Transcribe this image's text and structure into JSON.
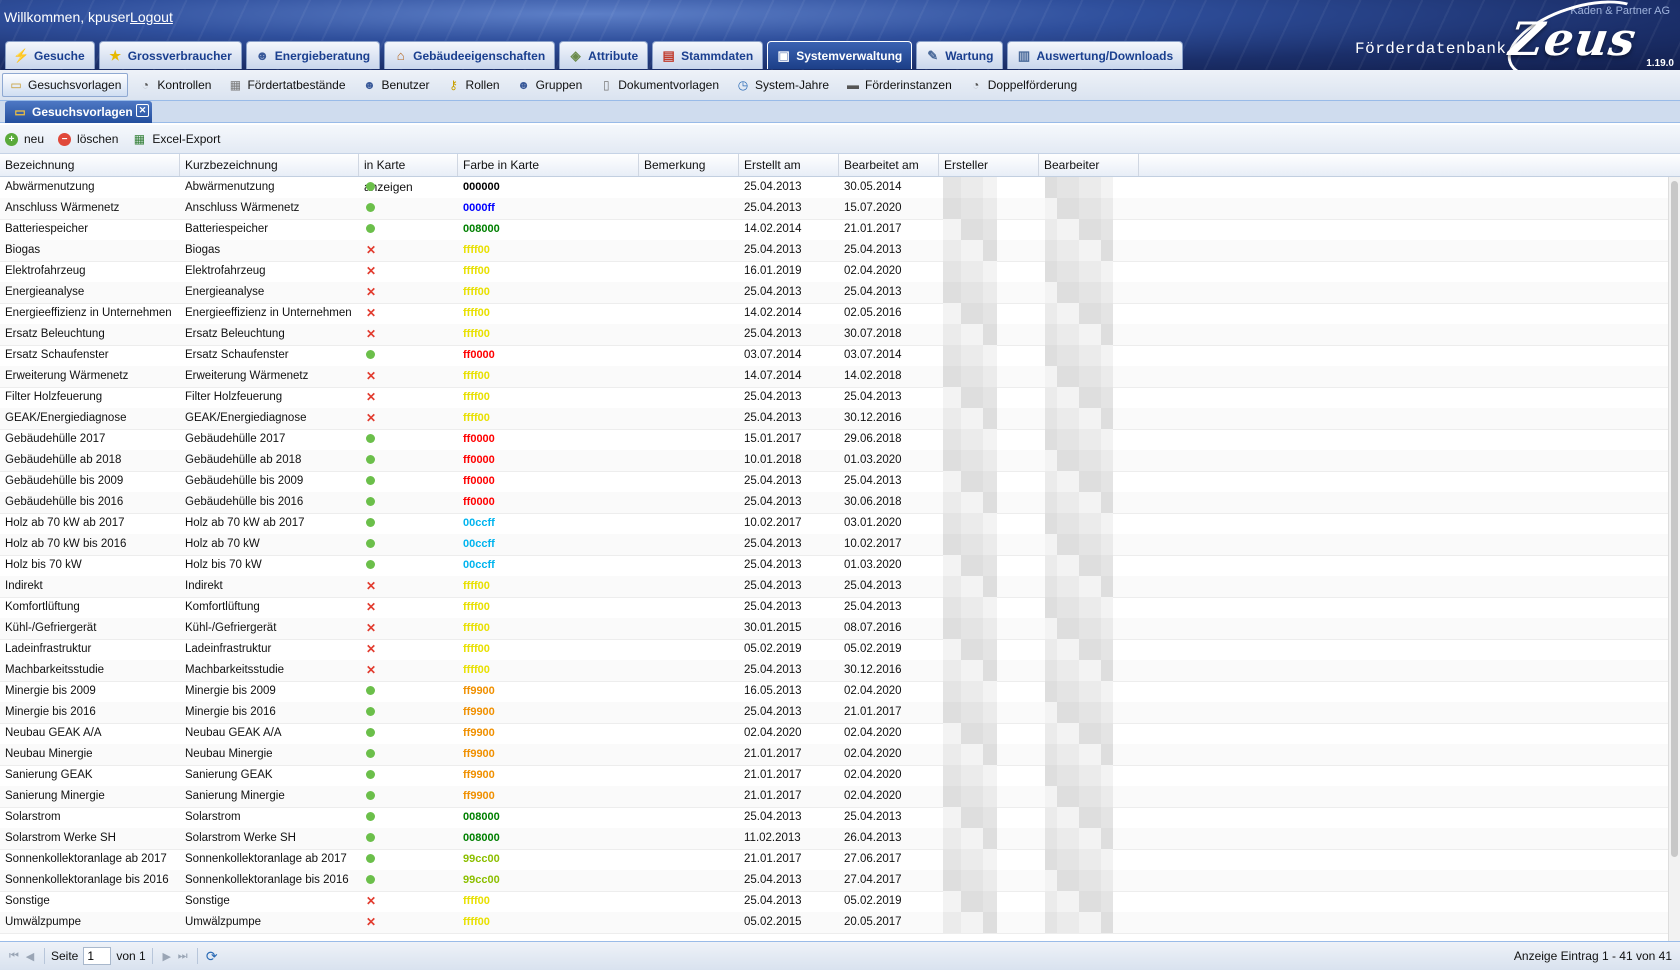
{
  "header": {
    "welcome": "Willkommen, kpuser",
    "logout": "Logout",
    "company": "Kaden & Partner AG",
    "app_name": "Förderdatenbank",
    "logo": "Zeus",
    "version": "1.19.0"
  },
  "main_tabs": [
    {
      "label": "Gesuche",
      "icon": "lightning-icon"
    },
    {
      "label": "Grossverbraucher",
      "icon": "star-icon"
    },
    {
      "label": "Energieberatung",
      "icon": "person-icon"
    },
    {
      "label": "Gebäudeeigenschaften",
      "icon": "house-icon"
    },
    {
      "label": "Attribute",
      "icon": "tag-icon"
    },
    {
      "label": "Stammdaten",
      "icon": "database-icon"
    },
    {
      "label": "Systemverwaltung",
      "icon": "window-icon",
      "active": true
    },
    {
      "label": "Wartung",
      "icon": "wrench-icon"
    },
    {
      "label": "Auswertung/Downloads",
      "icon": "report-icon"
    }
  ],
  "sub_tabs": [
    {
      "label": "Gesuchsvorlagen",
      "icon": "form-icon",
      "active": true
    },
    {
      "label": "Kontrollen",
      "icon": "check-icon"
    },
    {
      "label": "Fördertatbestände",
      "icon": "list-icon"
    },
    {
      "label": "Benutzer",
      "icon": "user-icon"
    },
    {
      "label": "Rollen",
      "icon": "key-icon"
    },
    {
      "label": "Gruppen",
      "icon": "group-icon"
    },
    {
      "label": "Dokumentvorlagen",
      "icon": "document-icon"
    },
    {
      "label": "System-Jahre",
      "icon": "clock-icon"
    },
    {
      "label": "Förderinstanzen",
      "icon": "truck-icon"
    },
    {
      "label": "Doppelförderung",
      "icon": "duplicate-icon"
    }
  ],
  "doc_tab": {
    "label": "Gesuchsvorlagen"
  },
  "toolbar": {
    "new": "neu",
    "delete": "löschen",
    "export": "Excel-Export"
  },
  "columns": [
    "Bezeichnung",
    "Kurzbezeichnung",
    "in Karte anzeigen",
    "Farbe in Karte",
    "Bemerkung",
    "Erstellt am",
    "Bearbeitet am",
    "Ersteller",
    "Bearbeiter"
  ],
  "colors": {
    "check": "#6bbf4a",
    "cross": "#e23b2e",
    "header_dark": "#1b2f6a",
    "tab_active": "#234e9d"
  },
  "rows": [
    {
      "bez": "Abwärmenutzung",
      "kurz": "Abwärmenutzung",
      "karte": true,
      "farbe": "000000",
      "fc": "#000000",
      "erstellt": "25.04.2013",
      "bearbeitet": "30.05.2014"
    },
    {
      "bez": "Anschluss Wärmenetz",
      "kurz": "Anschluss Wärmenetz",
      "karte": true,
      "farbe": "0000ff",
      "fc": "#0000ff",
      "erstellt": "25.04.2013",
      "bearbeitet": "15.07.2020"
    },
    {
      "bez": "Batteriespeicher",
      "kurz": "Batteriespeicher",
      "karte": true,
      "farbe": "008000",
      "fc": "#008000",
      "erstellt": "14.02.2014",
      "bearbeitet": "21.01.2017"
    },
    {
      "bez": "Biogas",
      "kurz": "Biogas",
      "karte": false,
      "farbe": "ffff00",
      "fc": "#e8e000",
      "erstellt": "25.04.2013",
      "bearbeitet": "25.04.2013"
    },
    {
      "bez": "Elektrofahrzeug",
      "kurz": "Elektrofahrzeug",
      "karte": false,
      "farbe": "ffff00",
      "fc": "#e8e000",
      "erstellt": "16.01.2019",
      "bearbeitet": "02.04.2020"
    },
    {
      "bez": "Energieanalyse",
      "kurz": "Energieanalyse",
      "karte": false,
      "farbe": "ffff00",
      "fc": "#e8e000",
      "erstellt": "25.04.2013",
      "bearbeitet": "25.04.2013"
    },
    {
      "bez": "Energieeffizienz in Unternehmen",
      "kurz": "Energieeffizienz in Unternehmen",
      "karte": false,
      "farbe": "ffff00",
      "fc": "#e8e000",
      "erstellt": "14.02.2014",
      "bearbeitet": "02.05.2016"
    },
    {
      "bez": "Ersatz Beleuchtung",
      "kurz": "Ersatz Beleuchtung",
      "karte": false,
      "farbe": "ffff00",
      "fc": "#e8e000",
      "erstellt": "25.04.2013",
      "bearbeitet": "30.07.2018"
    },
    {
      "bez": "Ersatz Schaufenster",
      "kurz": "Ersatz Schaufenster",
      "karte": true,
      "farbe": "ff0000",
      "fc": "#ff0000",
      "erstellt": "03.07.2014",
      "bearbeitet": "03.07.2014"
    },
    {
      "bez": "Erweiterung Wärmenetz",
      "kurz": "Erweiterung Wärmenetz",
      "karte": false,
      "farbe": "ffff00",
      "fc": "#e8e000",
      "erstellt": "14.07.2014",
      "bearbeitet": "14.02.2018"
    },
    {
      "bez": "Filter Holzfeuerung",
      "kurz": "Filter Holzfeuerung",
      "karte": false,
      "farbe": "ffff00",
      "fc": "#e8e000",
      "erstellt": "25.04.2013",
      "bearbeitet": "25.04.2013"
    },
    {
      "bez": "GEAK/Energiediagnose",
      "kurz": "GEAK/Energiediagnose",
      "karte": false,
      "farbe": "ffff00",
      "fc": "#e8e000",
      "erstellt": "25.04.2013",
      "bearbeitet": "30.12.2016"
    },
    {
      "bez": "Gebäudehülle 2017",
      "kurz": "Gebäudehülle 2017",
      "karte": true,
      "farbe": "ff0000",
      "fc": "#ff0000",
      "erstellt": "15.01.2017",
      "bearbeitet": "29.06.2018"
    },
    {
      "bez": "Gebäudehülle ab 2018",
      "kurz": "Gebäudehülle ab 2018",
      "karte": true,
      "farbe": "ff0000",
      "fc": "#ff0000",
      "erstellt": "10.01.2018",
      "bearbeitet": "01.03.2020"
    },
    {
      "bez": "Gebäudehülle bis 2009",
      "kurz": "Gebäudehülle bis 2009",
      "karte": true,
      "farbe": "ff0000",
      "fc": "#ff0000",
      "erstellt": "25.04.2013",
      "bearbeitet": "25.04.2013"
    },
    {
      "bez": "Gebäudehülle bis 2016",
      "kurz": "Gebäudehülle bis 2016",
      "karte": true,
      "farbe": "ff0000",
      "fc": "#ff0000",
      "erstellt": "25.04.2013",
      "bearbeitet": "30.06.2018"
    },
    {
      "bez": "Holz ab 70 kW ab 2017",
      "kurz": "Holz ab 70 kW ab 2017",
      "karte": true,
      "farbe": "00ccff",
      "fc": "#00b4ee",
      "erstellt": "10.02.2017",
      "bearbeitet": "03.01.2020"
    },
    {
      "bez": "Holz ab 70 kW bis 2016",
      "kurz": "Holz ab 70 kW",
      "karte": true,
      "farbe": "00ccff",
      "fc": "#00b4ee",
      "erstellt": "25.04.2013",
      "bearbeitet": "10.02.2017"
    },
    {
      "bez": "Holz bis 70 kW",
      "kurz": "Holz bis 70 kW",
      "karte": true,
      "farbe": "00ccff",
      "fc": "#00b4ee",
      "erstellt": "25.04.2013",
      "bearbeitet": "01.03.2020"
    },
    {
      "bez": "Indirekt",
      "kurz": "Indirekt",
      "karte": false,
      "farbe": "ffff00",
      "fc": "#e8e000",
      "erstellt": "25.04.2013",
      "bearbeitet": "25.04.2013"
    },
    {
      "bez": "Komfortlüftung",
      "kurz": "Komfortlüftung",
      "karte": false,
      "farbe": "ffff00",
      "fc": "#e8e000",
      "erstellt": "25.04.2013",
      "bearbeitet": "25.04.2013"
    },
    {
      "bez": "Kühl-/Gefriergerät",
      "kurz": "Kühl-/Gefriergerät",
      "karte": false,
      "farbe": "ffff00",
      "fc": "#e8e000",
      "erstellt": "30.01.2015",
      "bearbeitet": "08.07.2016"
    },
    {
      "bez": "Ladeinfrastruktur",
      "kurz": "Ladeinfrastruktur",
      "karte": false,
      "farbe": "ffff00",
      "fc": "#e8e000",
      "erstellt": "05.02.2019",
      "bearbeitet": "05.02.2019"
    },
    {
      "bez": "Machbarkeitsstudie",
      "kurz": "Machbarkeitsstudie",
      "karte": false,
      "farbe": "ffff00",
      "fc": "#e8e000",
      "erstellt": "25.04.2013",
      "bearbeitet": "30.12.2016"
    },
    {
      "bez": "Minergie bis 2009",
      "kurz": "Minergie bis 2009",
      "karte": true,
      "farbe": "ff9900",
      "fc": "#f09000",
      "erstellt": "16.05.2013",
      "bearbeitet": "02.04.2020"
    },
    {
      "bez": "Minergie bis 2016",
      "kurz": "Minergie bis 2016",
      "karte": true,
      "farbe": "ff9900",
      "fc": "#f09000",
      "erstellt": "25.04.2013",
      "bearbeitet": "21.01.2017"
    },
    {
      "bez": "Neubau GEAK A/A",
      "kurz": "Neubau GEAK A/A",
      "karte": true,
      "farbe": "ff9900",
      "fc": "#f09000",
      "erstellt": "02.04.2020",
      "bearbeitet": "02.04.2020"
    },
    {
      "bez": "Neubau Minergie",
      "kurz": "Neubau Minergie",
      "karte": true,
      "farbe": "ff9900",
      "fc": "#f09000",
      "erstellt": "21.01.2017",
      "bearbeitet": "02.04.2020"
    },
    {
      "bez": "Sanierung GEAK",
      "kurz": "Sanierung GEAK",
      "karte": true,
      "farbe": "ff9900",
      "fc": "#f09000",
      "erstellt": "21.01.2017",
      "bearbeitet": "02.04.2020"
    },
    {
      "bez": "Sanierung Minergie",
      "kurz": "Sanierung Minergie",
      "karte": true,
      "farbe": "ff9900",
      "fc": "#f09000",
      "erstellt": "21.01.2017",
      "bearbeitet": "02.04.2020"
    },
    {
      "bez": "Solarstrom",
      "kurz": "Solarstrom",
      "karte": true,
      "farbe": "008000",
      "fc": "#008000",
      "erstellt": "25.04.2013",
      "bearbeitet": "25.04.2013"
    },
    {
      "bez": "Solarstrom Werke SH",
      "kurz": "Solarstrom Werke SH",
      "karte": true,
      "farbe": "008000",
      "fc": "#008000",
      "erstellt": "11.02.2013",
      "bearbeitet": "26.04.2013"
    },
    {
      "bez": "Sonnenkollektoranlage ab 2017",
      "kurz": "Sonnenkollektoranlage ab 2017",
      "karte": true,
      "farbe": "99cc00",
      "fc": "#8cbf00",
      "erstellt": "21.01.2017",
      "bearbeitet": "27.06.2017"
    },
    {
      "bez": "Sonnenkollektoranlage bis 2016",
      "kurz": "Sonnenkollektoranlage bis 2016",
      "karte": true,
      "farbe": "99cc00",
      "fc": "#8cbf00",
      "erstellt": "25.04.2013",
      "bearbeitet": "27.04.2017"
    },
    {
      "bez": "Sonstige",
      "kurz": "Sonstige",
      "karte": false,
      "farbe": "ffff00",
      "fc": "#e8e000",
      "erstellt": "25.04.2013",
      "bearbeitet": "05.02.2019"
    },
    {
      "bez": "Umwälzpumpe",
      "kurz": "Umwälzpumpe",
      "karte": false,
      "farbe": "ffff00",
      "fc": "#e8e000",
      "erstellt": "05.02.2015",
      "bearbeitet": "20.05.2017"
    }
  ],
  "paging": {
    "page_label": "Seite",
    "page": "1",
    "of_label": "von 1",
    "display": "Anzeige Eintrag 1 - 41 von 41"
  }
}
